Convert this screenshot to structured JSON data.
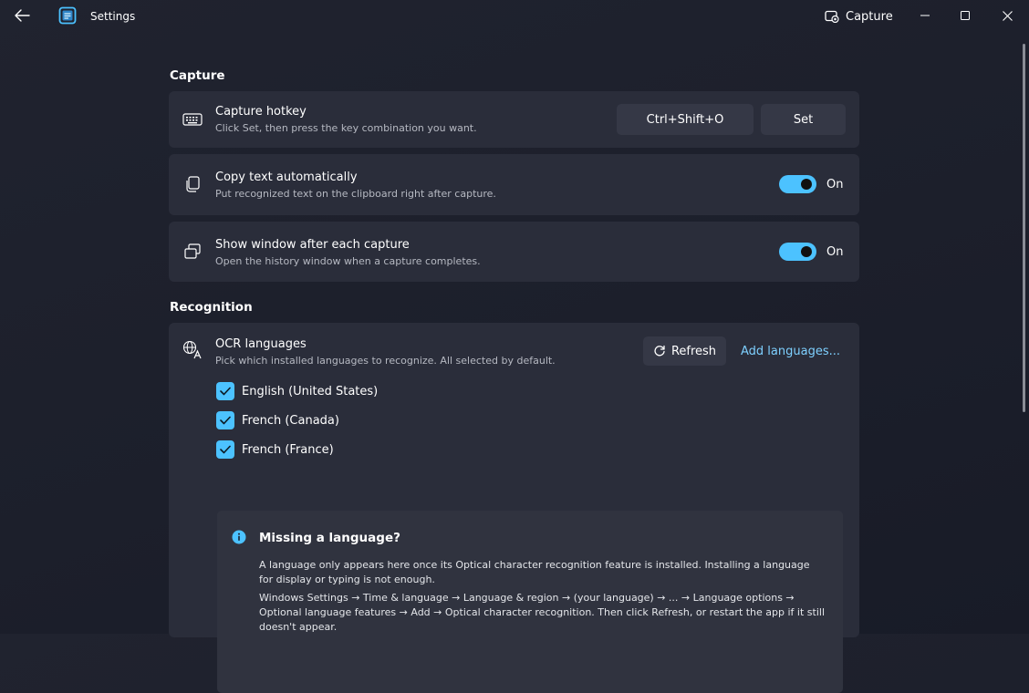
{
  "titlebar": {
    "title": "Settings",
    "capture_label": "Capture"
  },
  "sections": {
    "capture": "Capture",
    "recognition": "Recognition"
  },
  "hotkey": {
    "title": "Capture hotkey",
    "description": "Click Set, then press the key combination you want.",
    "value": "Ctrl+Shift+O",
    "set_label": "Set"
  },
  "copy_text": {
    "title": "Copy text automatically",
    "description": "Put recognized text on the clipboard right after capture.",
    "state_label": "On",
    "enabled": true
  },
  "show_window": {
    "title": "Show window after each capture",
    "description": "Open the history window when a capture completes.",
    "state_label": "On",
    "enabled": true
  },
  "ocr": {
    "title": "OCR languages",
    "description": "Pick which installed languages to recognize. All selected by default.",
    "refresh_label": "Refresh",
    "add_label": "Add languages...",
    "languages": [
      {
        "label": "English (United States)",
        "checked": true
      },
      {
        "label": "French (Canada)",
        "checked": true
      },
      {
        "label": "French (France)",
        "checked": true
      }
    ]
  },
  "info": {
    "title": "Missing a language?",
    "paragraph1": "A language only appears here once its Optical character recognition feature is installed. Installing a language for display or typing is not enough.",
    "paragraph2": "Windows Settings → Time & language → Language & region → (your language) → ... → Language options → Optional language features → Add → Optical character recognition. Then click Refresh, or restart the app if it still doesn't appear."
  },
  "colors": {
    "accent": "#4cc2ff",
    "link": "#7ed0ff",
    "card": "#2a2d3a",
    "button": "#353846",
    "background": "#1c1f2b"
  }
}
